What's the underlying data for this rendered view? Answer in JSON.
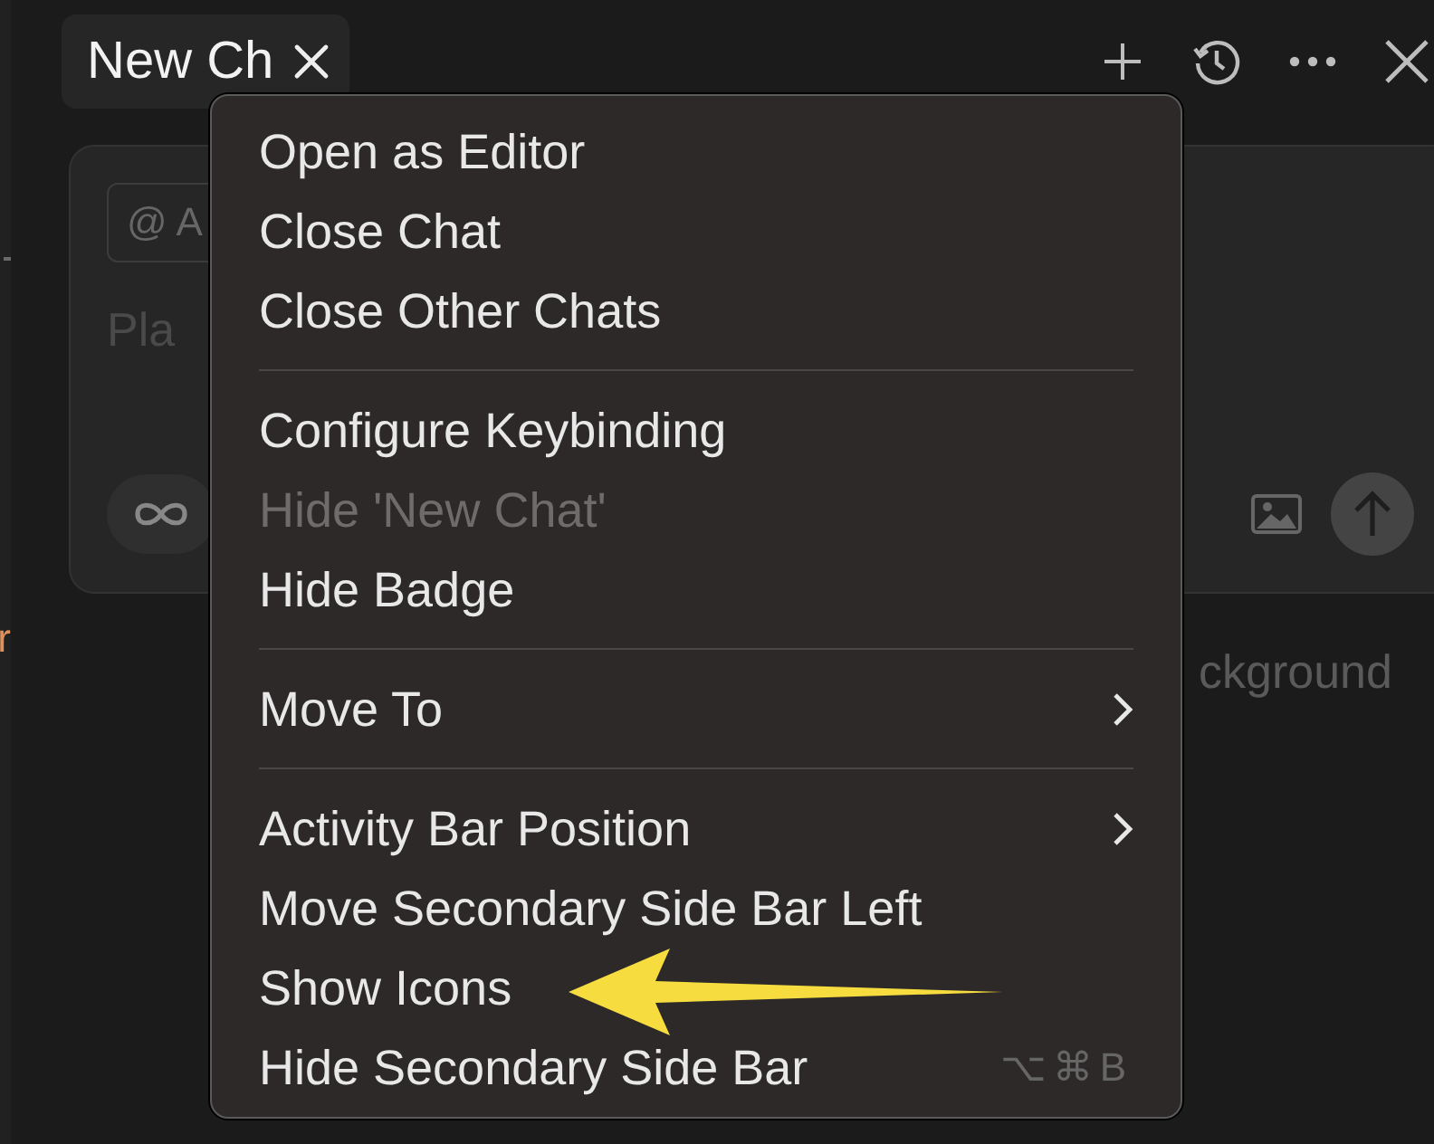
{
  "side_strip": {
    "text": "r"
  },
  "tab": {
    "label": "New Ch",
    "selected": true
  },
  "composer": {
    "context_chip": "@ A",
    "placeholder": "Pla"
  },
  "hint_text": "ckground",
  "menu": {
    "sections": [
      {
        "items": [
          {
            "label": "Open as Editor",
            "disabled": false
          },
          {
            "label": "Close Chat",
            "disabled": false
          },
          {
            "label": "Close Other Chats",
            "disabled": false
          }
        ]
      },
      {
        "items": [
          {
            "label": "Configure Keybinding",
            "disabled": false
          },
          {
            "label": "Hide 'New Chat'",
            "disabled": true
          },
          {
            "label": "Hide Badge",
            "disabled": false
          }
        ]
      },
      {
        "items": [
          {
            "label": "Move To",
            "disabled": false,
            "submenu": true
          }
        ]
      },
      {
        "items": [
          {
            "label": "Activity Bar Position",
            "disabled": false,
            "submenu": true
          },
          {
            "label": "Move Secondary Side Bar Left",
            "disabled": false
          },
          {
            "label": "Show Icons",
            "disabled": false
          },
          {
            "label": "Hide Secondary Side Bar",
            "disabled": false,
            "shortcut": "⌥⌘B"
          }
        ]
      }
    ]
  }
}
